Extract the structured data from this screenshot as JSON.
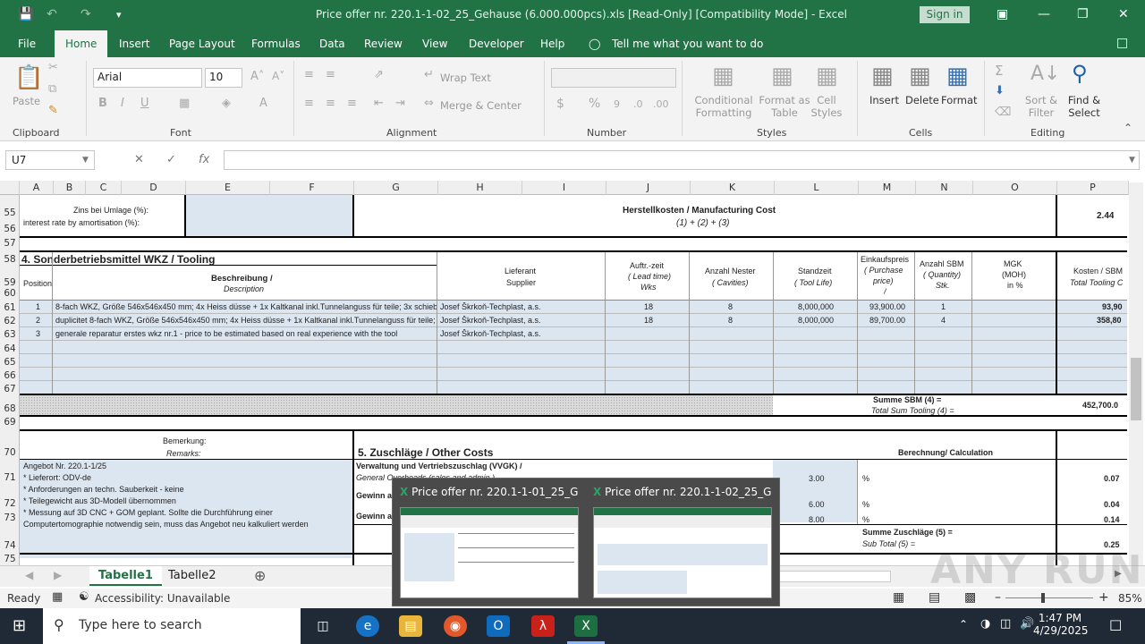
{
  "title": "Price offer nr. 220.1-1-02_25_Gehause (6.000.000pcs).xls  [Read-Only]  [Compatibility Mode]  -  Excel",
  "signin": "Sign in",
  "menu": [
    "File",
    "Home",
    "Insert",
    "Page Layout",
    "Formulas",
    "Data",
    "Review",
    "View",
    "Developer",
    "Help"
  ],
  "tell_me": "Tell me what you want to do",
  "ribbon": {
    "paste": "Paste",
    "font_name": "Arial",
    "font_size": "10",
    "wrap_text": "Wrap Text",
    "merge_center": "Merge & Center",
    "conditional": [
      "Conditional",
      "Formatting"
    ],
    "format_table": [
      "Format as",
      "Table"
    ],
    "cell_styles": [
      "Cell",
      "Styles"
    ],
    "insert": "Insert",
    "delete": "Delete",
    "format": "Format",
    "sort": [
      "Sort &",
      "Filter"
    ],
    "find": [
      "Find &",
      "Select"
    ],
    "groups": [
      "Clipboard",
      "Font",
      "Alignment",
      "Number",
      "Styles",
      "Cells",
      "Editing"
    ]
  },
  "namebox": "U7",
  "fx": "fx",
  "columns": [
    "A",
    "B",
    "C",
    "D",
    "E",
    "F",
    "G",
    "H",
    "I",
    "J",
    "K",
    "L",
    "M",
    "N",
    "O",
    "P"
  ],
  "rows": [
    "55",
    "56",
    "57",
    "58",
    "59",
    "60",
    "61",
    "62",
    "63",
    "64",
    "65",
    "66",
    "67",
    "68",
    "69",
    "70",
    "71",
    "72",
    "73",
    "74",
    "75"
  ],
  "sheet": {
    "zins1": "Zins bei Umlage (%):",
    "zins2": "interest rate by amortisation (%):",
    "herst1": "Herstellkosten / Manufacturing Cost",
    "herst2": "(1) + (2) + (3)",
    "val_244": "2.44",
    "section4": "4. Sonderbetriebsmittel WKZ / Tooling",
    "position": "Position",
    "beschreibung": "Beschreibung /",
    "description": "Description",
    "lieferant": "Lieferant",
    "supplier": "Supplier",
    "auftr": "Auftr.-zeit",
    "leadtime": "( Lead time)",
    "wks": "Wks",
    "nester": "Anzahl Nester",
    "cavities": "( Cavities)",
    "standzeit": "Standzeit",
    "toollife": "( Tool Life)",
    "einkauf": "Einkaufspreis",
    "purchase": "( Purchase",
    "price": "price)",
    "slash": "/",
    "anzahl_sbm": "Anzahl SBM",
    "quantity": "( Quantity)",
    "stk": "Stk.",
    "mgk": "MGK",
    "moh": "(MOH)",
    "inpct": "in %",
    "kosten": "Kosten / SBM",
    "total_tooling": "Total Tooling C",
    "r1": [
      "1",
      "8-fach WKZ, Größe 546x546x450 mm; 4x Heiss düsse + 1x Kaltkanal inkl.Tunnelanguss für teile; 3x schiebe",
      "Josef Škrkoň-Techplast, a.s.",
      "18",
      "8",
      "8,000,000",
      "93,900.00",
      "1",
      "93,90"
    ],
    "r2": [
      "2",
      "duplicitet 8-fach WKZ, Größe 546x546x450 mm; 4x Heiss düsse + 1x Kaltkanal inkl.Tunnelanguss für teile;",
      "Josef Škrkoň-Techplast, a.s.",
      "18",
      "8",
      "8,000,000",
      "89,700.00",
      "4",
      "358,80"
    ],
    "r3": [
      "3",
      "generale reparatur erstes wkz nr.1 - price to be estimated based on real experience with the tool",
      "Josef Škrkoň-Techplast, a.s."
    ],
    "summe_sbm": "Summe SBM (4) =",
    "total_sum_tooling": "Total Sum Tooling (4) =",
    "val_452": "452,700.0",
    "bemerkung": "Bemerkung:",
    "remarks": "Remarks:",
    "section5": "5. Zuschläge / Other Costs",
    "berechnung": "Berechnung/  Calculation",
    "angebot": "Angebot Nr. 220.1-1/25",
    "rem1": "*   Lieferort:  ODV-de",
    "rem2": "*   Anforderungen an techn. Sauberkeit - keine",
    "rem3": "*   Teilegewicht aus 3D-Modell übernommen",
    "rem4": "*   Messung auf 3D CNC + GOM geplant. Sollte die Durchführung einer",
    "rem5": "Computertomographie notwendig sein, muss das Angebot neu kalkuliert werden",
    "vvgk": "Verwaltung und Vertriebszuschlag (VVGK) /",
    "gen_overheads": "General Overheads (sales and admin.)",
    "gewinn1": "Gewinn auf Material",
    "gewinn2": "Gewinn auf",
    "v300": "3.00",
    "v600": "6.00",
    "v800": "8.00",
    "pct": "%",
    "v007": "0.07",
    "v004": "0.04",
    "v014": "0.14",
    "summe_zuschlaege": "Summe Zuschläge (5) =",
    "subtotal5": "Sub Total (5) =",
    "v025": "0.25"
  },
  "tabs": [
    "Tabelle1",
    "Tabelle2"
  ],
  "status": {
    "ready": "Ready",
    "accessibility": "Accessibility: Unavailable",
    "zoom": "85%"
  },
  "taskbar": {
    "search": "Type here to search",
    "time": "1:47 PM",
    "date": "4/29/2025"
  },
  "thumbs": [
    "Price offer nr. 220.1-1-01_25_Ge...",
    "Price offer nr. 220.1-1-02_25_Ge..."
  ],
  "watermark": "ANY RUN"
}
